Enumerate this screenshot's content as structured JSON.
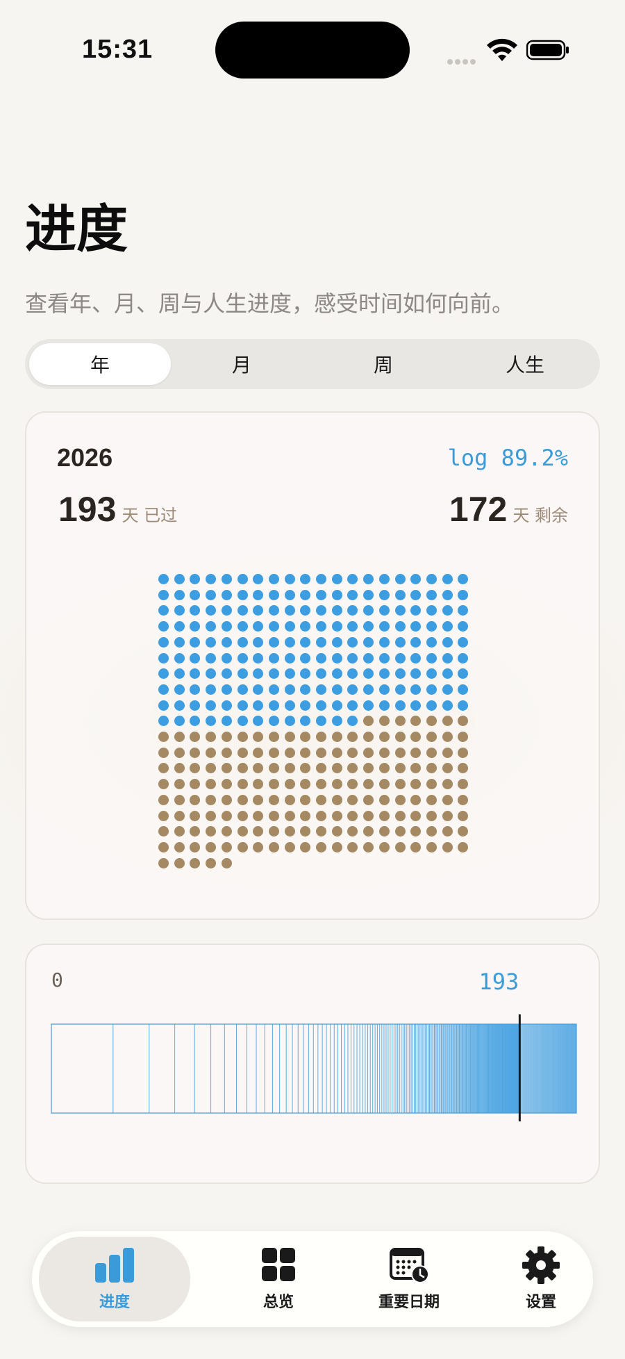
{
  "status_bar": {
    "time": "15:31"
  },
  "header": {
    "title": "进度",
    "subtitle": "查看年、月、周与人生进度，感受时间如何向前。"
  },
  "segments": [
    {
      "label": "年",
      "active": true
    },
    {
      "label": "月",
      "active": false
    },
    {
      "label": "周",
      "active": false
    },
    {
      "label": "人生",
      "active": false
    }
  ],
  "year_card": {
    "year": "2026",
    "log_percent": "log 89.2%",
    "days_passed": "193",
    "days_passed_unit": "天 已过",
    "days_left": "172",
    "days_left_unit": "天 剩余",
    "total_days": 365,
    "passed_days": 193,
    "columns": 20,
    "colors": {
      "past": "#3c9de0",
      "future": "#a48963"
    }
  },
  "log_strip": {
    "start_label": "0",
    "current_label": "193",
    "start": 1,
    "end": 365,
    "current": 193,
    "line_color": "#3c9de0",
    "marker_color": "#1b1b1b"
  },
  "tab_bar": {
    "items": [
      {
        "label": "进度",
        "icon": "bar-chart-icon",
        "active": true
      },
      {
        "label": "总览",
        "icon": "grid-icon",
        "active": false
      },
      {
        "label": "重要日期",
        "icon": "calendar-clock-icon",
        "active": false
      },
      {
        "label": "设置",
        "icon": "gear-icon",
        "active": false
      }
    ]
  },
  "colors": {
    "accent": "#3b9bd8",
    "background": "#f7f5f2"
  }
}
